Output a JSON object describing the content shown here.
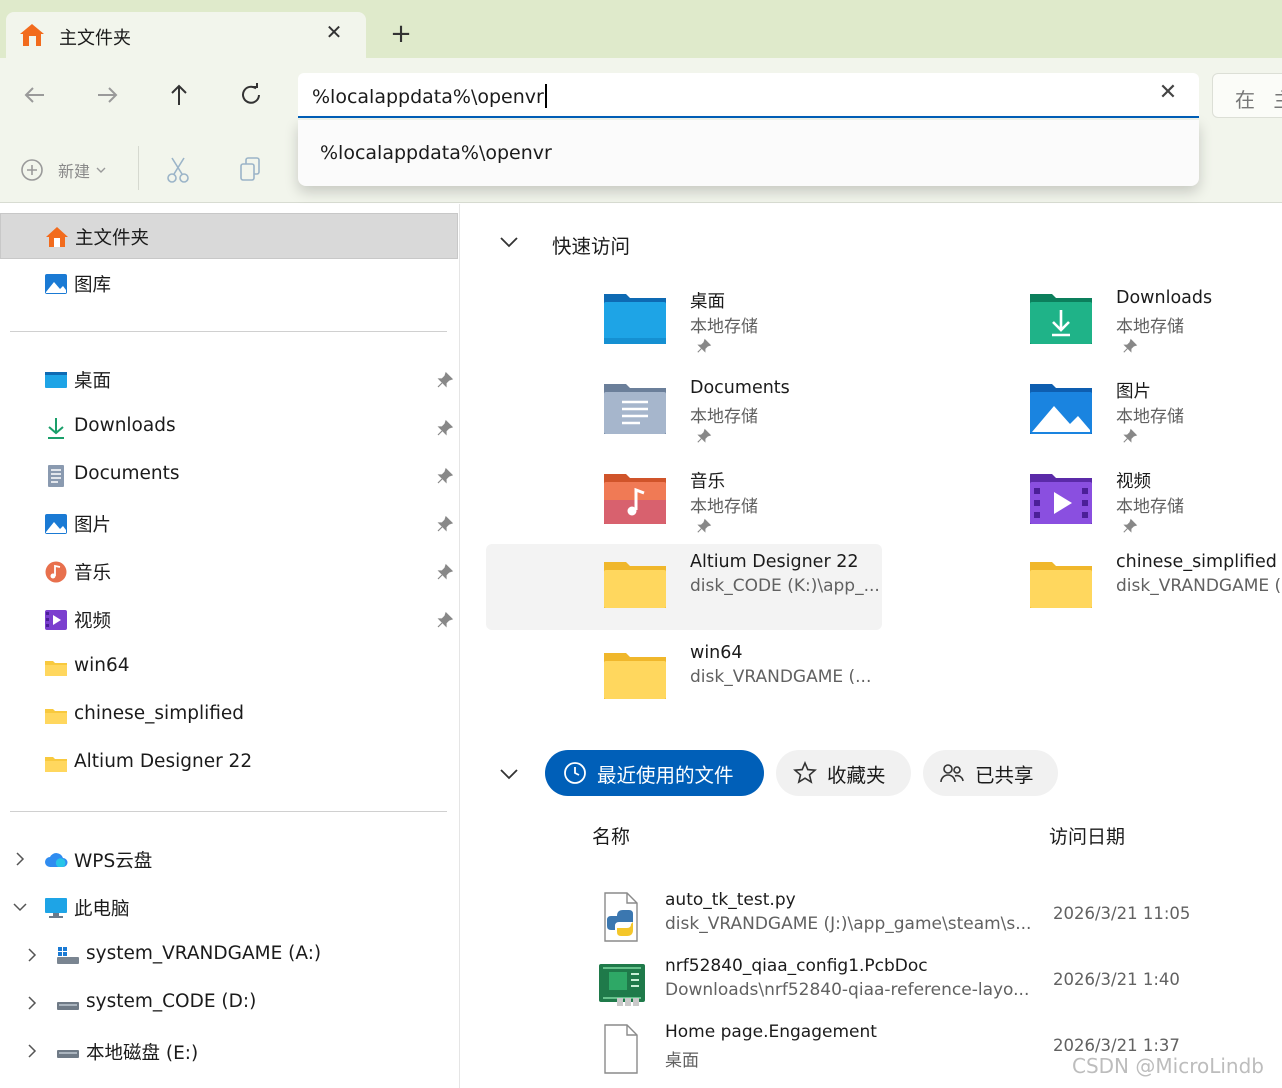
{
  "tab": {
    "title": "主文件夹",
    "close_icon": "close-icon",
    "new_tab_label": "+"
  },
  "address": {
    "value": "%localappdata%\\openvr",
    "suggestion": "%localappdata%\\openvr"
  },
  "search": {
    "placeholder": "在 主"
  },
  "toolbar": {
    "new_label": "新建"
  },
  "sidebar": {
    "home": "主文件夹",
    "gallery": "图库",
    "pinned": [
      {
        "label": "桌面",
        "icon": "desktop-icon"
      },
      {
        "label": "Downloads",
        "icon": "download-icon"
      },
      {
        "label": "Documents",
        "icon": "documents-icon"
      },
      {
        "label": "图片",
        "icon": "pictures-icon"
      },
      {
        "label": "音乐",
        "icon": "music-icon"
      },
      {
        "label": "视频",
        "icon": "videos-icon"
      }
    ],
    "recent_folders": [
      "win64",
      "chinese_simplified",
      "Altium Designer 22"
    ],
    "wps": "WPS云盘",
    "this_pc": "此电脑",
    "drives": [
      "system_VRANDGAME (A:)",
      "system_CODE (D:)",
      "本地磁盘 (E:)"
    ]
  },
  "quick_access": {
    "title": "快速访问",
    "items": [
      {
        "name": "桌面",
        "sub": "本地存储",
        "pinned": true
      },
      {
        "name": "Downloads",
        "sub": "本地存储",
        "pinned": true
      },
      {
        "name": "Documents",
        "sub": "本地存储",
        "pinned": true
      },
      {
        "name": "图片",
        "sub": "本地存储",
        "pinned": true
      },
      {
        "name": "音乐",
        "sub": "本地存储",
        "pinned": true
      },
      {
        "name": "视频",
        "sub": "本地存储",
        "pinned": true
      },
      {
        "name": "Altium Designer 22",
        "sub": "disk_CODE (K:)\\app_..."
      },
      {
        "name": "chinese_simplified",
        "sub": "disk_VRANDGAME (..."
      },
      {
        "name": "win64",
        "sub": "disk_VRANDGAME (..."
      }
    ]
  },
  "recent": {
    "tabs": [
      "最近使用的文件",
      "收藏夹",
      "已共享"
    ],
    "columns": {
      "name": "名称",
      "date": "访问日期"
    },
    "files": [
      {
        "name": "auto_tk_test.py",
        "path": "disk_VRANDGAME (J:)\\app_game\\steam\\s...",
        "date": "2026/3/21 11:05",
        "icon": "python-file-icon"
      },
      {
        "name": "nrf52840_qiaa_config1.PcbDoc",
        "path": "Downloads\\nrf52840-qiaa-reference-layo...",
        "date": "2026/3/21 1:40",
        "icon": "pcb-file-icon"
      },
      {
        "name": "Home page.Engagement",
        "path": "桌面",
        "date": "2026/3/21 1:37",
        "icon": "blank-file-icon"
      }
    ]
  },
  "watermark": "CSDN @MicroLindb",
  "colors": {
    "accent": "#005fb8",
    "folder_yellow": "#f8c93e",
    "titlebar": "#dfeacb"
  }
}
